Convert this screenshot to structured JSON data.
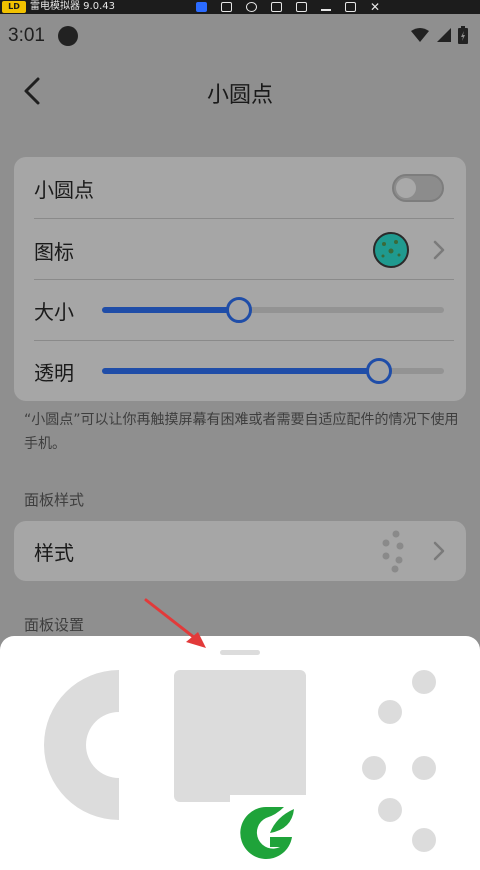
{
  "emulator": {
    "title": "雷电模拟器 9.0.43",
    "logo": "LD"
  },
  "status": {
    "time": "3:01"
  },
  "header": {
    "title": "小圆点"
  },
  "settings": {
    "rows": [
      {
        "label": "小圆点"
      },
      {
        "label": "图标"
      },
      {
        "label": "大小",
        "value": 0.4
      },
      {
        "label": "透明",
        "value": 0.81
      }
    ],
    "toggle_on": false
  },
  "description": "“小圆点”可以让你再触摸屏幕有困难或者需要自适应配件的情况下使用手机。",
  "panel_style": {
    "section": "面板样式",
    "label": "样式"
  },
  "panel_settings": {
    "section": "面板设置"
  },
  "colors": {
    "accent": "#1f4da8",
    "background_dim": "#8f8f8f",
    "card": "#a6a6a6"
  },
  "icons": [
    "back-arrow",
    "chevron-right",
    "globe-dot",
    "dots-style",
    "wifi",
    "signal",
    "battery"
  ]
}
